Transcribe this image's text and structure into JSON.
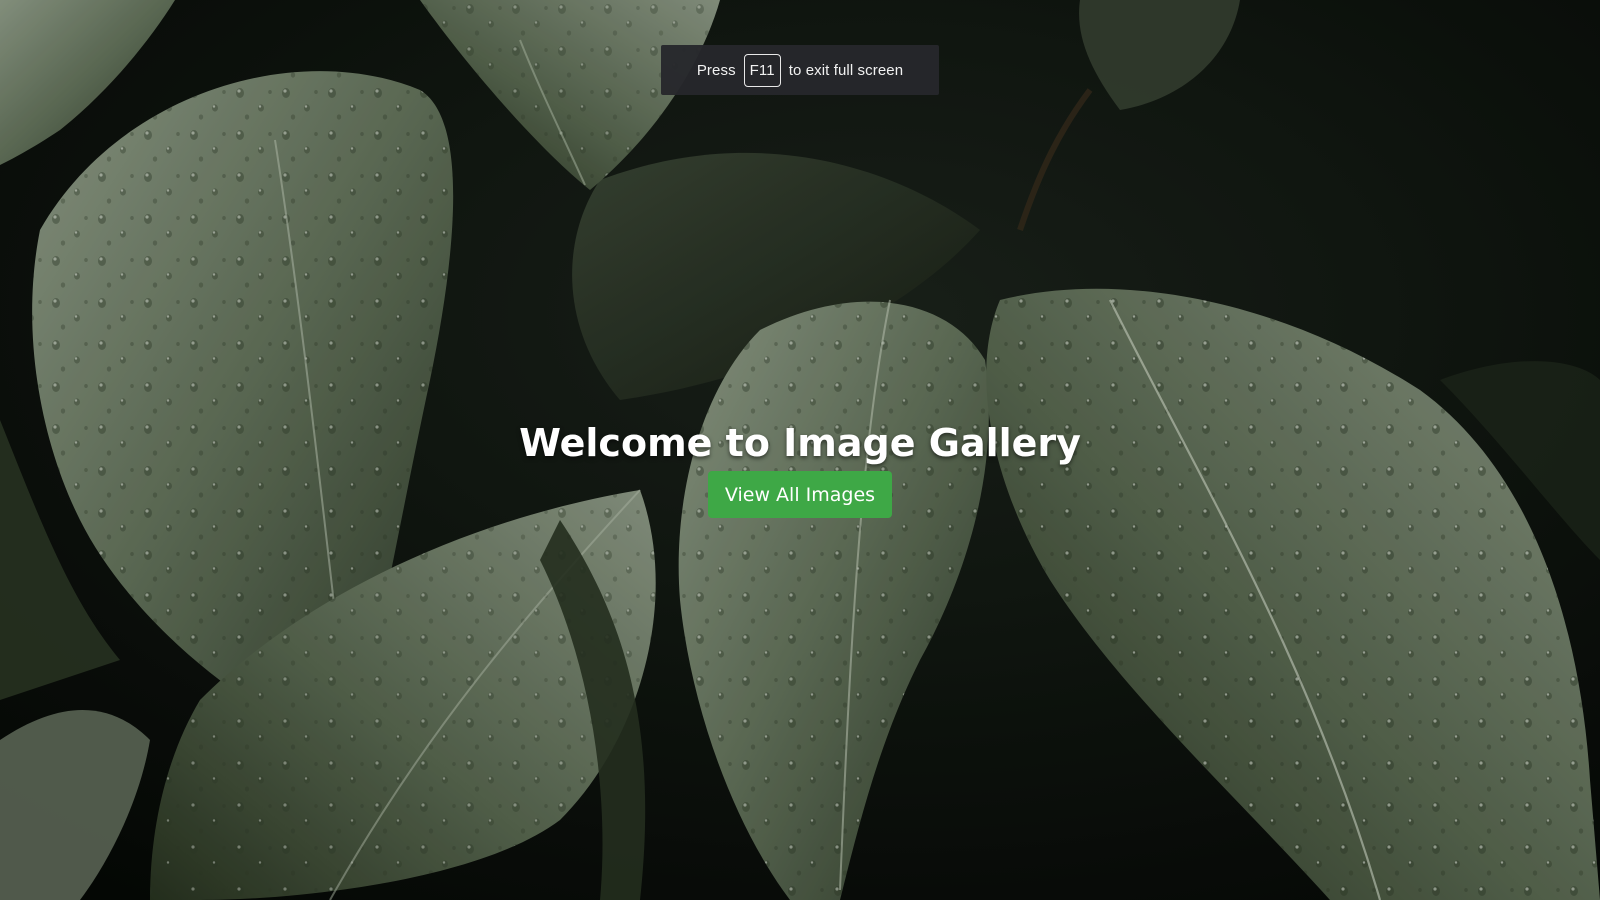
{
  "fullscreen_notice": {
    "prefix": "Press",
    "key": "F11",
    "suffix": "to exit full screen"
  },
  "hero": {
    "title": "Welcome to Image Gallery",
    "button_label": "View All Images",
    "button_color": "#3ea846",
    "background_subject": "dark green leaves with water droplets"
  }
}
